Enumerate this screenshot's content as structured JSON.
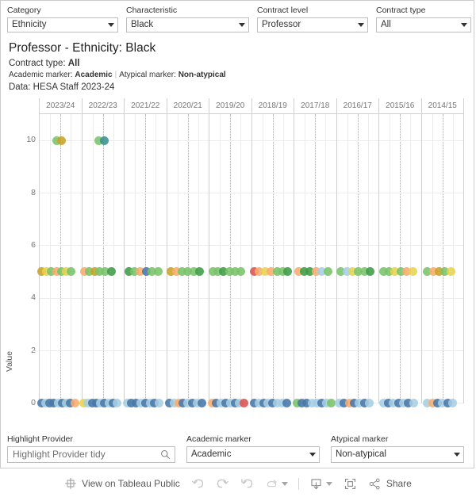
{
  "top_filters": [
    {
      "label": "Category",
      "value": "Ethnicity"
    },
    {
      "label": "Characteristic",
      "value": "Black"
    },
    {
      "label": "Contract level",
      "value": "Professor"
    },
    {
      "label": "Contract type",
      "value": "All"
    }
  ],
  "title": {
    "main": "Professor - Ethnicity: Black",
    "contract_type_label": "Contract type: ",
    "contract_type_value": "All",
    "academic_marker_label": "Academic marker: ",
    "academic_marker_value": "Academic",
    "separator": "|",
    "atypical_marker_label": "Atypical marker: ",
    "atypical_marker_value": "Non-atypical",
    "data_source": "Data: HESA Staff 2023-24"
  },
  "bottom_filters": {
    "highlight": {
      "label": "Highlight Provider",
      "value": "Highlight Provider tidy",
      "icon": "search-icon"
    },
    "academic_marker": {
      "label": "Academic marker",
      "value": "Academic"
    },
    "atypical_marker": {
      "label": "Atypical marker",
      "value": "Non-atypical"
    }
  },
  "toolbar": {
    "logo_name": "tableau-logo-icon",
    "view_label": "View on Tableau Public",
    "undo_name": "undo-icon",
    "redo_name": "redo-icon",
    "revert_name": "revert-icon",
    "refresh_name": "refresh-icon",
    "download_name": "download-icon",
    "fullscreen_name": "fullscreen-icon",
    "share_name": "share-icon",
    "share_label": "Share"
  },
  "chart_data": {
    "type": "scatter",
    "title": "Professor - Ethnicity: Black",
    "xlabel": "",
    "ylabel": "Value",
    "ylim": [
      0,
      11
    ],
    "yticks": [
      0,
      2,
      4,
      6,
      8,
      10
    ],
    "grid": true,
    "legend": "none",
    "categories": [
      "2023/24",
      "2022/23",
      "2021/22",
      "2020/21",
      "2019/20",
      "2018/19",
      "2017/18",
      "2016/17",
      "2015/16",
      "2014/15"
    ],
    "colors": {
      "green": "#7ac36a",
      "dark_green": "#3f9c48",
      "orange": "#f8ac6c",
      "dark_orange": "#ef8a22",
      "yellow": "#e8d44d",
      "dark_yellow": "#c9a227",
      "steel_blue": "#4878a8",
      "light_blue": "#a6cee3",
      "teal": "#3b8f93",
      "red": "#d9534f"
    },
    "panels": [
      {
        "year": "2023/24",
        "points": [
          {
            "v": 10,
            "o": -0.1,
            "c": "green"
          },
          {
            "v": 10,
            "o": 0.02,
            "c": "dark_yellow"
          },
          {
            "v": 5,
            "o": -0.46,
            "c": "dark_yellow"
          },
          {
            "v": 5,
            "o": -0.34,
            "c": "yellow"
          },
          {
            "v": 5,
            "o": -0.22,
            "c": "green"
          },
          {
            "v": 5,
            "o": -0.1,
            "c": "orange"
          },
          {
            "v": 5,
            "o": 0.02,
            "c": "green"
          },
          {
            "v": 5,
            "o": 0.14,
            "c": "yellow"
          },
          {
            "v": 5,
            "o": 0.26,
            "c": "green"
          },
          {
            "v": 0,
            "o": -0.46,
            "c": "steel_blue"
          },
          {
            "v": 0,
            "o": -0.36,
            "c": "light_blue"
          },
          {
            "v": 0,
            "o": -0.26,
            "c": "steel_blue"
          },
          {
            "v": 0,
            "o": -0.16,
            "c": "steel_blue"
          },
          {
            "v": 0,
            "o": -0.06,
            "c": "light_blue"
          },
          {
            "v": 0,
            "o": 0.04,
            "c": "steel_blue"
          },
          {
            "v": 0,
            "o": 0.14,
            "c": "light_blue"
          },
          {
            "v": 0,
            "o": 0.24,
            "c": "steel_blue"
          },
          {
            "v": 0,
            "o": 0.34,
            "c": "orange"
          }
        ]
      },
      {
        "year": "2022/23",
        "points": [
          {
            "v": 10,
            "o": -0.1,
            "c": "green"
          },
          {
            "v": 10,
            "o": 0.04,
            "c": "teal"
          },
          {
            "v": 5,
            "o": -0.44,
            "c": "orange"
          },
          {
            "v": 5,
            "o": -0.32,
            "c": "green"
          },
          {
            "v": 5,
            "o": -0.2,
            "c": "dark_yellow"
          },
          {
            "v": 5,
            "o": -0.08,
            "c": "green"
          },
          {
            "v": 5,
            "o": 0.06,
            "c": "green"
          },
          {
            "v": 5,
            "o": 0.2,
            "c": "dark_green"
          },
          {
            "v": 0,
            "o": -0.46,
            "c": "yellow"
          },
          {
            "v": 0,
            "o": -0.36,
            "c": "light_blue"
          },
          {
            "v": 0,
            "o": -0.26,
            "c": "steel_blue"
          },
          {
            "v": 0,
            "o": -0.16,
            "c": "steel_blue"
          },
          {
            "v": 0,
            "o": -0.06,
            "c": "light_blue"
          },
          {
            "v": 0,
            "o": 0.04,
            "c": "steel_blue"
          },
          {
            "v": 0,
            "o": 0.14,
            "c": "light_blue"
          },
          {
            "v": 0,
            "o": 0.24,
            "c": "steel_blue"
          },
          {
            "v": 0,
            "o": 0.34,
            "c": "light_blue"
          }
        ]
      },
      {
        "year": "2021/22",
        "points": [
          {
            "v": 5,
            "o": -0.4,
            "c": "dark_green"
          },
          {
            "v": 5,
            "o": -0.26,
            "c": "green"
          },
          {
            "v": 5,
            "o": -0.12,
            "c": "orange"
          },
          {
            "v": 5,
            "o": 0.02,
            "c": "steel_blue"
          },
          {
            "v": 5,
            "o": 0.16,
            "c": "green"
          },
          {
            "v": 5,
            "o": 0.3,
            "c": "green"
          },
          {
            "v": 0,
            "o": -0.44,
            "c": "light_blue"
          },
          {
            "v": 0,
            "o": -0.33,
            "c": "steel_blue"
          },
          {
            "v": 0,
            "o": -0.22,
            "c": "steel_blue"
          },
          {
            "v": 0,
            "o": -0.11,
            "c": "light_blue"
          },
          {
            "v": 0,
            "o": 0.0,
            "c": "steel_blue"
          },
          {
            "v": 0,
            "o": 0.11,
            "c": "light_blue"
          },
          {
            "v": 0,
            "o": 0.22,
            "c": "steel_blue"
          },
          {
            "v": 0,
            "o": 0.33,
            "c": "light_blue"
          }
        ]
      },
      {
        "year": "2020/21",
        "points": [
          {
            "v": 5,
            "o": -0.4,
            "c": "dark_yellow"
          },
          {
            "v": 5,
            "o": -0.28,
            "c": "orange"
          },
          {
            "v": 5,
            "o": -0.14,
            "c": "green"
          },
          {
            "v": 5,
            "o": 0.0,
            "c": "green"
          },
          {
            "v": 5,
            "o": 0.14,
            "c": "green"
          },
          {
            "v": 5,
            "o": 0.28,
            "c": "dark_green"
          },
          {
            "v": 0,
            "o": -0.44,
            "c": "steel_blue"
          },
          {
            "v": 0,
            "o": -0.33,
            "c": "light_blue"
          },
          {
            "v": 0,
            "o": -0.22,
            "c": "orange"
          },
          {
            "v": 0,
            "o": -0.11,
            "c": "steel_blue"
          },
          {
            "v": 0,
            "o": 0.0,
            "c": "light_blue"
          },
          {
            "v": 0,
            "o": 0.11,
            "c": "steel_blue"
          },
          {
            "v": 0,
            "o": 0.22,
            "c": "light_blue"
          },
          {
            "v": 0,
            "o": 0.33,
            "c": "steel_blue"
          }
        ]
      },
      {
        "year": "2019/20",
        "points": [
          {
            "v": 5,
            "o": -0.42,
            "c": "green"
          },
          {
            "v": 5,
            "o": -0.3,
            "c": "green"
          },
          {
            "v": 5,
            "o": -0.16,
            "c": "dark_green"
          },
          {
            "v": 5,
            "o": -0.02,
            "c": "green"
          },
          {
            "v": 5,
            "o": 0.12,
            "c": "green"
          },
          {
            "v": 5,
            "o": 0.26,
            "c": "green"
          },
          {
            "v": 0,
            "o": -0.44,
            "c": "orange"
          },
          {
            "v": 0,
            "o": -0.33,
            "c": "steel_blue"
          },
          {
            "v": 0,
            "o": -0.22,
            "c": "light_blue"
          },
          {
            "v": 0,
            "o": -0.11,
            "c": "steel_blue"
          },
          {
            "v": 0,
            "o": 0.0,
            "c": "light_blue"
          },
          {
            "v": 0,
            "o": 0.11,
            "c": "steel_blue"
          },
          {
            "v": 0,
            "o": 0.22,
            "c": "light_blue"
          },
          {
            "v": 0,
            "o": 0.33,
            "c": "red"
          }
        ]
      },
      {
        "year": "2018/19",
        "points": [
          {
            "v": 5,
            "o": -0.44,
            "c": "red"
          },
          {
            "v": 5,
            "o": -0.32,
            "c": "orange"
          },
          {
            "v": 5,
            "o": -0.18,
            "c": "yellow"
          },
          {
            "v": 5,
            "o": -0.04,
            "c": "orange"
          },
          {
            "v": 5,
            "o": 0.1,
            "c": "green"
          },
          {
            "v": 5,
            "o": 0.24,
            "c": "green"
          },
          {
            "v": 5,
            "o": 0.36,
            "c": "dark_green"
          },
          {
            "v": 0,
            "o": -0.44,
            "c": "steel_blue"
          },
          {
            "v": 0,
            "o": -0.33,
            "c": "light_blue"
          },
          {
            "v": 0,
            "o": -0.22,
            "c": "steel_blue"
          },
          {
            "v": 0,
            "o": -0.11,
            "c": "light_blue"
          },
          {
            "v": 0,
            "o": 0.0,
            "c": "steel_blue"
          },
          {
            "v": 0,
            "o": 0.11,
            "c": "light_blue"
          },
          {
            "v": 0,
            "o": 0.22,
            "c": "light_blue"
          },
          {
            "v": 0,
            "o": 0.33,
            "c": "steel_blue"
          }
        ]
      },
      {
        "year": "2017/18",
        "points": [
          {
            "v": 5,
            "o": -0.4,
            "c": "orange"
          },
          {
            "v": 5,
            "o": -0.26,
            "c": "dark_green"
          },
          {
            "v": 5,
            "o": -0.12,
            "c": "dark_green"
          },
          {
            "v": 5,
            "o": 0.02,
            "c": "orange"
          },
          {
            "v": 5,
            "o": 0.16,
            "c": "light_blue"
          },
          {
            "v": 5,
            "o": 0.3,
            "c": "green"
          },
          {
            "v": 0,
            "o": -0.44,
            "c": "green"
          },
          {
            "v": 0,
            "o": -0.32,
            "c": "steel_blue"
          },
          {
            "v": 0,
            "o": -0.2,
            "c": "steel_blue"
          },
          {
            "v": 0,
            "o": -0.08,
            "c": "light_blue"
          },
          {
            "v": 0,
            "o": 0.04,
            "c": "light_blue"
          },
          {
            "v": 0,
            "o": 0.16,
            "c": "steel_blue"
          },
          {
            "v": 0,
            "o": 0.28,
            "c": "light_blue"
          },
          {
            "v": 0,
            "o": 0.38,
            "c": "green"
          }
        ]
      },
      {
        "year": "2016/17",
        "points": [
          {
            "v": 5,
            "o": -0.4,
            "c": "green"
          },
          {
            "v": 5,
            "o": -0.26,
            "c": "light_blue"
          },
          {
            "v": 5,
            "o": -0.12,
            "c": "yellow"
          },
          {
            "v": 5,
            "o": 0.02,
            "c": "green"
          },
          {
            "v": 5,
            "o": 0.16,
            "c": "green"
          },
          {
            "v": 5,
            "o": 0.3,
            "c": "dark_green"
          },
          {
            "v": 0,
            "o": -0.44,
            "c": "light_blue"
          },
          {
            "v": 0,
            "o": -0.32,
            "c": "steel_blue"
          },
          {
            "v": 0,
            "o": -0.2,
            "c": "orange"
          },
          {
            "v": 0,
            "o": -0.08,
            "c": "steel_blue"
          },
          {
            "v": 0,
            "o": 0.04,
            "c": "light_blue"
          },
          {
            "v": 0,
            "o": 0.16,
            "c": "steel_blue"
          },
          {
            "v": 0,
            "o": 0.28,
            "c": "light_blue"
          }
        ]
      },
      {
        "year": "2015/16",
        "points": [
          {
            "v": 5,
            "o": -0.4,
            "c": "green"
          },
          {
            "v": 5,
            "o": -0.26,
            "c": "green"
          },
          {
            "v": 5,
            "o": -0.12,
            "c": "yellow"
          },
          {
            "v": 5,
            "o": 0.02,
            "c": "green"
          },
          {
            "v": 5,
            "o": 0.16,
            "c": "orange"
          },
          {
            "v": 5,
            "o": 0.3,
            "c": "yellow"
          },
          {
            "v": 0,
            "o": -0.4,
            "c": "light_blue"
          },
          {
            "v": 0,
            "o": -0.28,
            "c": "steel_blue"
          },
          {
            "v": 0,
            "o": -0.16,
            "c": "light_blue"
          },
          {
            "v": 0,
            "o": -0.04,
            "c": "steel_blue"
          },
          {
            "v": 0,
            "o": 0.08,
            "c": "light_blue"
          },
          {
            "v": 0,
            "o": 0.2,
            "c": "steel_blue"
          },
          {
            "v": 0,
            "o": 0.32,
            "c": "light_blue"
          }
        ]
      },
      {
        "year": "2014/15",
        "points": [
          {
            "v": 5,
            "o": -0.36,
            "c": "green"
          },
          {
            "v": 5,
            "o": -0.22,
            "c": "orange"
          },
          {
            "v": 5,
            "o": -0.08,
            "c": "dark_yellow"
          },
          {
            "v": 5,
            "o": 0.06,
            "c": "green"
          },
          {
            "v": 5,
            "o": 0.2,
            "c": "yellow"
          },
          {
            "v": 0,
            "o": -0.36,
            "c": "light_blue"
          },
          {
            "v": 0,
            "o": -0.24,
            "c": "orange"
          },
          {
            "v": 0,
            "o": -0.12,
            "c": "steel_blue"
          },
          {
            "v": 0,
            "o": 0.0,
            "c": "light_blue"
          },
          {
            "v": 0,
            "o": 0.12,
            "c": "steel_blue"
          },
          {
            "v": 0,
            "o": 0.24,
            "c": "light_blue"
          }
        ]
      }
    ]
  }
}
